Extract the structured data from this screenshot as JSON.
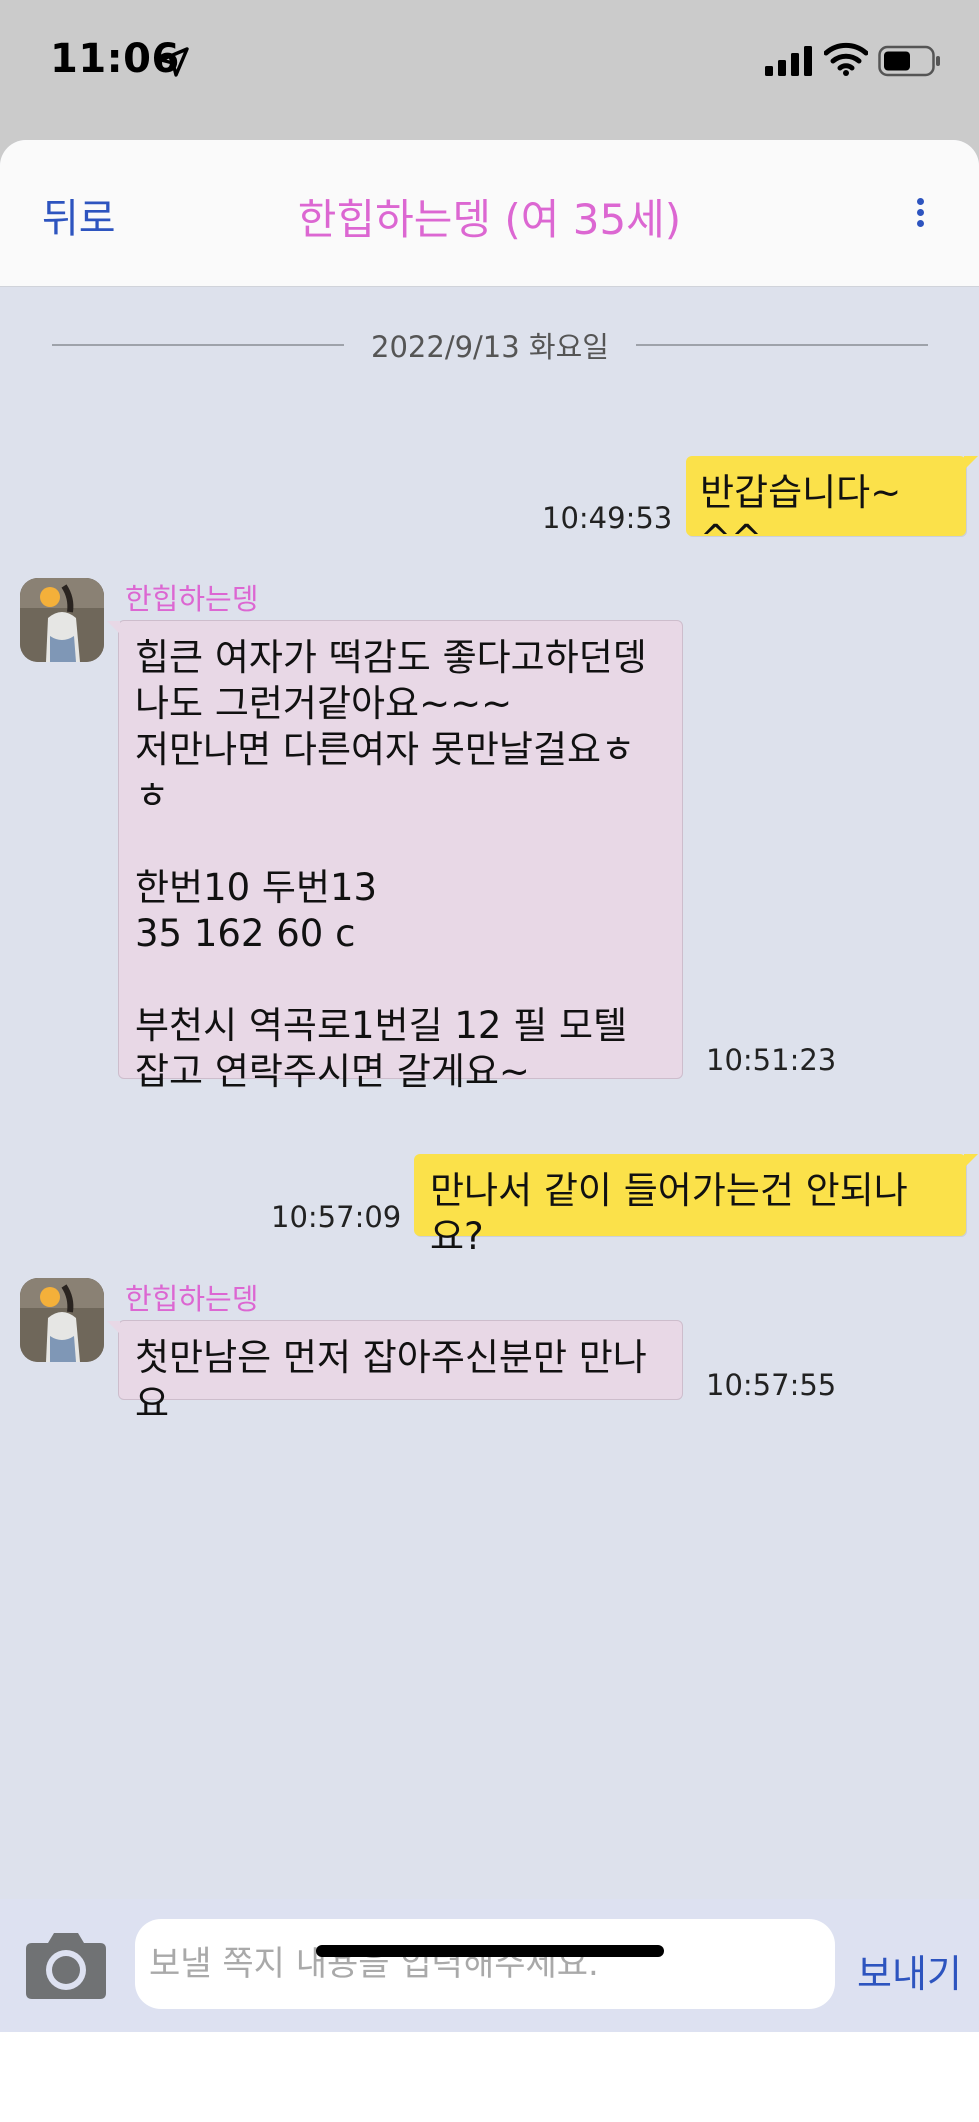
{
  "status_bar": {
    "time": "11:06",
    "icons": [
      "location-arrow-icon",
      "cellular-signal-icon",
      "wifi-icon",
      "battery-icon"
    ]
  },
  "nav": {
    "back_label": "뒤로",
    "title": "한힙하는뎅 (여 35세)",
    "more_icon": "more-vertical-icon"
  },
  "date_divider": "2022/9/13 화요일",
  "messages": [
    {
      "direction": "out",
      "text": "반갑습니다~ ^^",
      "time": "10:49:53"
    },
    {
      "direction": "in",
      "sender": "한힙하는뎅",
      "text": "힙큰 여자가 떡감도 좋다고하던뎅\n나도 그런거같아요~~~\n저만나면 다른여자 못만날걸요ㅎㅎ\n\n한번10 두번13\n35 162 60 c\n\n부천시 역곡로1번길 12 필 모텔\n잡고 연락주시면 갈게요~",
      "time": "10:51:23"
    },
    {
      "direction": "out",
      "text": "만나서 같이 들어가는건 안되나요?",
      "time": "10:57:09"
    },
    {
      "direction": "in",
      "sender": "한힙하는뎅",
      "text": "첫만남은 먼저 잡아주신분만 만나요",
      "time": "10:57:55"
    }
  ],
  "input": {
    "placeholder": "보낼 쪽지 내용을 입력해주세요.",
    "value": "",
    "send_label": "보내기",
    "camera_icon": "camera-icon"
  },
  "colors": {
    "accent_blue": "#2d54bf",
    "title_pink": "#dc67d2",
    "outgoing_bubble": "#fbe14a",
    "incoming_bubble": "#e8d8e6",
    "chat_background": "#dde1ec"
  }
}
